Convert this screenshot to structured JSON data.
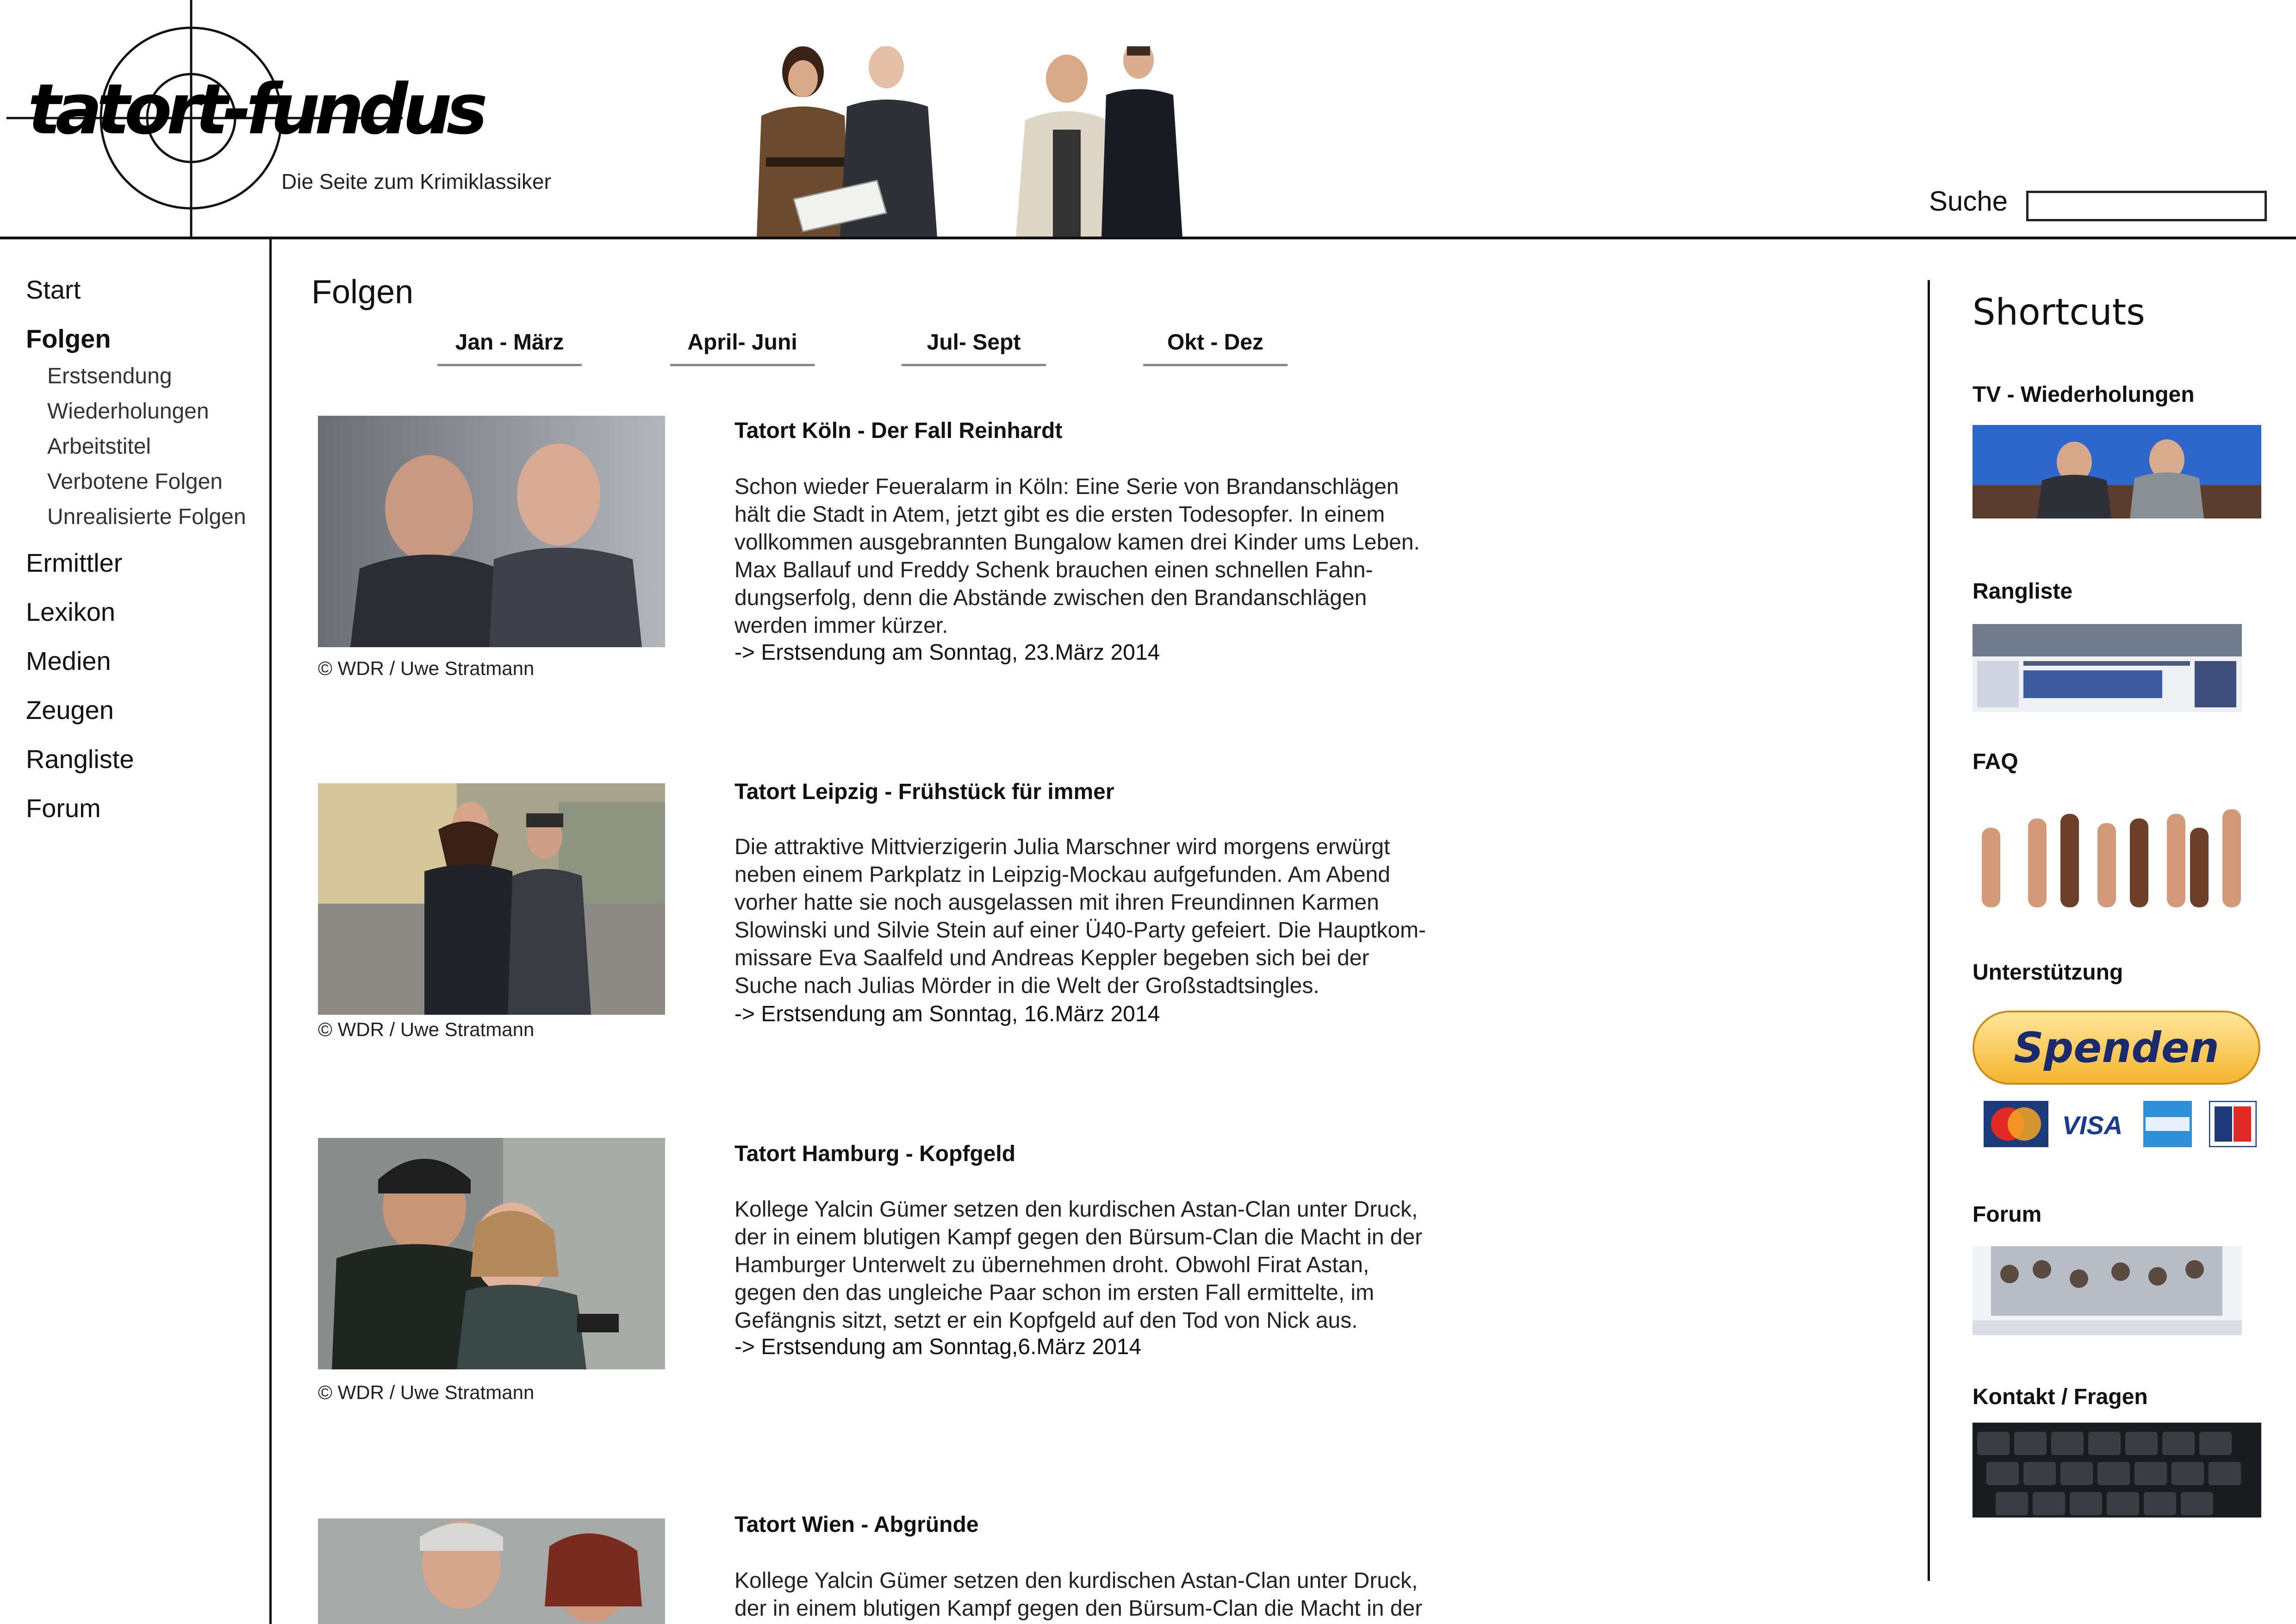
{
  "header": {
    "logo_text": "tatort-fundus",
    "tagline": "Die Seite zum Krimiklassiker",
    "search_label": "Suche",
    "search_value": ""
  },
  "nav": {
    "main_items": [
      {
        "label": "Start"
      },
      {
        "label": "Folgen"
      },
      {
        "label": "Ermittler"
      },
      {
        "label": "Lexikon"
      },
      {
        "label": "Medien"
      },
      {
        "label": "Zeugen"
      },
      {
        "label": "Rangliste"
      },
      {
        "label": "Forum"
      }
    ],
    "sub_items": [
      {
        "label": "Erstsendung"
      },
      {
        "label": "Wiederholungen"
      },
      {
        "label": "Arbeitstitel"
      },
      {
        "label": "Verbotene Folgen"
      },
      {
        "label": "Unrealisierte Folgen"
      }
    ],
    "active": "Folgen"
  },
  "main": {
    "title": "Folgen",
    "tabs": [
      {
        "label": "Jan - März"
      },
      {
        "label": "April- Juni"
      },
      {
        "label": "Jul- Sept"
      },
      {
        "label": "Okt - Dez"
      }
    ],
    "entries": [
      {
        "title": "Tatort Köln  - Der Fall Reinhardt",
        "text": "Schon wieder Feueralarm in Köln: Eine Serie von Brandanschlägen\nhält die Stadt in Atem, jetzt gibt es die ersten Todesopfer. In einem\nvollkommen ausgebrannten Bungalow kamen drei Kinder ums Leben.\nMax Ballauf und Freddy Schenk brauchen einen schnellen Fahn-\ndungserfolg, denn die Abstände zwischen den Brandanschlägen\nwerden immer kürzer.",
        "link": "-> Erstsendung am Sonntag, 23.März 2014",
        "credit": "© WDR / Uwe Stratmann"
      },
      {
        "title": "Tatort Leipzig  - Frühstück für immer",
        "text": "Die attraktive Mittvierzigerin Julia Marschner wird morgens erwürgt\nneben einem Parkplatz in Leipzig-Mockau aufgefunden. Am Abend\nvorher hatte sie noch ausgelassen mit ihren Freundinnen Karmen\nSlowinski und Silvie Stein auf einer Ü40-Party gefeiert. Die Hauptkom-\nmissare Eva Saalfeld und Andreas Keppler begeben sich bei der\nSuche nach Julias Mörder in die Welt der Großstadtsingles.",
        "link": "-> Erstsendung am Sonntag, 16.März 2014",
        "credit": "© WDR / Uwe Stratmann"
      },
      {
        "title": "Tatort Hamburg  - Kopfgeld",
        "text": "Kollege Yalcin Gümer setzen den kurdischen Astan-Clan unter Druck,\nder in einem blutigen Kampf gegen den Bürsum-Clan die Macht in der\nHamburger Unterwelt zu übernehmen droht. Obwohl Firat Astan,\ngegen den das ungleiche Paar schon im ersten Fall ermittelte, im\nGefängnis sitzt, setzt er ein Kopfgeld auf den Tod von Nick aus.",
        "link": "-> Erstsendung am Sonntag,6.März 2014",
        "credit": "© WDR / Uwe Stratmann"
      },
      {
        "title": "Tatort Wien  - Abgründe",
        "text": "Kollege Yalcin Gümer setzen den kurdischen Astan-Clan unter Druck,\nder in einem blutigen Kampf gegen den Bürsum-Clan die Macht in der",
        "link": "",
        "credit": ""
      }
    ]
  },
  "sidebar": {
    "title": "Shortcuts",
    "items": [
      {
        "label": "TV - Wiederholungen"
      },
      {
        "label": "Rangliste"
      },
      {
        "label": "FAQ"
      },
      {
        "label": "Unterstützung"
      },
      {
        "label": "Forum"
      },
      {
        "label": "Kontakt / Fragen"
      }
    ],
    "donate_button": "Spenden",
    "payment_logos": [
      "MasterCard",
      "VISA",
      "AMEX",
      "EC"
    ],
    "visa_text": "VISA"
  }
}
